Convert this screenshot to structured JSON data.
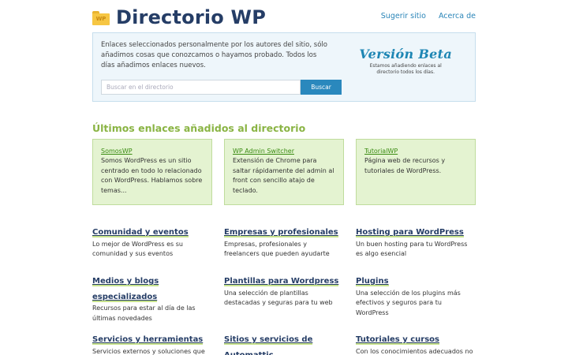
{
  "header": {
    "folder_label": "WP",
    "title": "Directorio WP",
    "nav": [
      "Sugerir sitio",
      "Acerca de"
    ]
  },
  "hero": {
    "text": "Enlaces seleccionados personalmente por los autores del sitio, sólo añadimos cosas que conozcamos o hayamos probado. Todos los días añadimos enlaces nuevos.",
    "search_placeholder": "Buscar en el directorio",
    "search_value": "",
    "search_button": "Buscar",
    "beta_title": "Versión Beta",
    "beta_sub": "Estamos añadiendo enlaces al directorio todos los días."
  },
  "latest": {
    "title": "Últimos enlaces añadidos al directorio",
    "cards": [
      {
        "link": "SomosWP",
        "desc": "Somos WordPress es un sitio centrado en todo lo relacionado con WordPress. Hablamos sobre temas..."
      },
      {
        "link": "WP Admin Switcher",
        "desc": "Extensión de Chrome para saltar rápidamente del admin al front con sencillo atajo de teclado."
      },
      {
        "link": "TutorialWP",
        "desc": "Página web de recursos y tutoriales de WordPress."
      }
    ]
  },
  "categories": [
    {
      "title": "Comunidad y eventos",
      "desc": "Lo mejor de WordPress es su comunidad y sus eventos"
    },
    {
      "title": "Empresas y profesionales",
      "desc": "Empresas, profesionales y freelancers que pueden ayudarte"
    },
    {
      "title": "Hosting para WordPress",
      "desc": "Un buen hosting para tu WordPress es algo esencial"
    },
    {
      "title": "Medios y blogs especializados",
      "desc": "Recursos para estar al día de las últimas novedades"
    },
    {
      "title": "Plantillas para Wordpress",
      "desc": "Una selección de plantillas destacadas y seguras para tu web"
    },
    {
      "title": "Plugins",
      "desc": "Una selección de los plugins más efectivos y seguros para tu WordPress"
    },
    {
      "title": "Servicios y herramientas",
      "desc": "Servicios externos y soluciones que"
    },
    {
      "title": "Sitios y servicios de Automattic",
      "desc": ""
    },
    {
      "title": "Tutoriales y cursos",
      "desc": "Con los conocimientos adecuados no"
    }
  ],
  "colors": {
    "title": "#253d66",
    "link": "#2a85b8",
    "accent_green": "#8ab444",
    "card_bg": "#e4f3d1",
    "hero_bg": "#eef6fb",
    "button": "#2a88bd"
  }
}
